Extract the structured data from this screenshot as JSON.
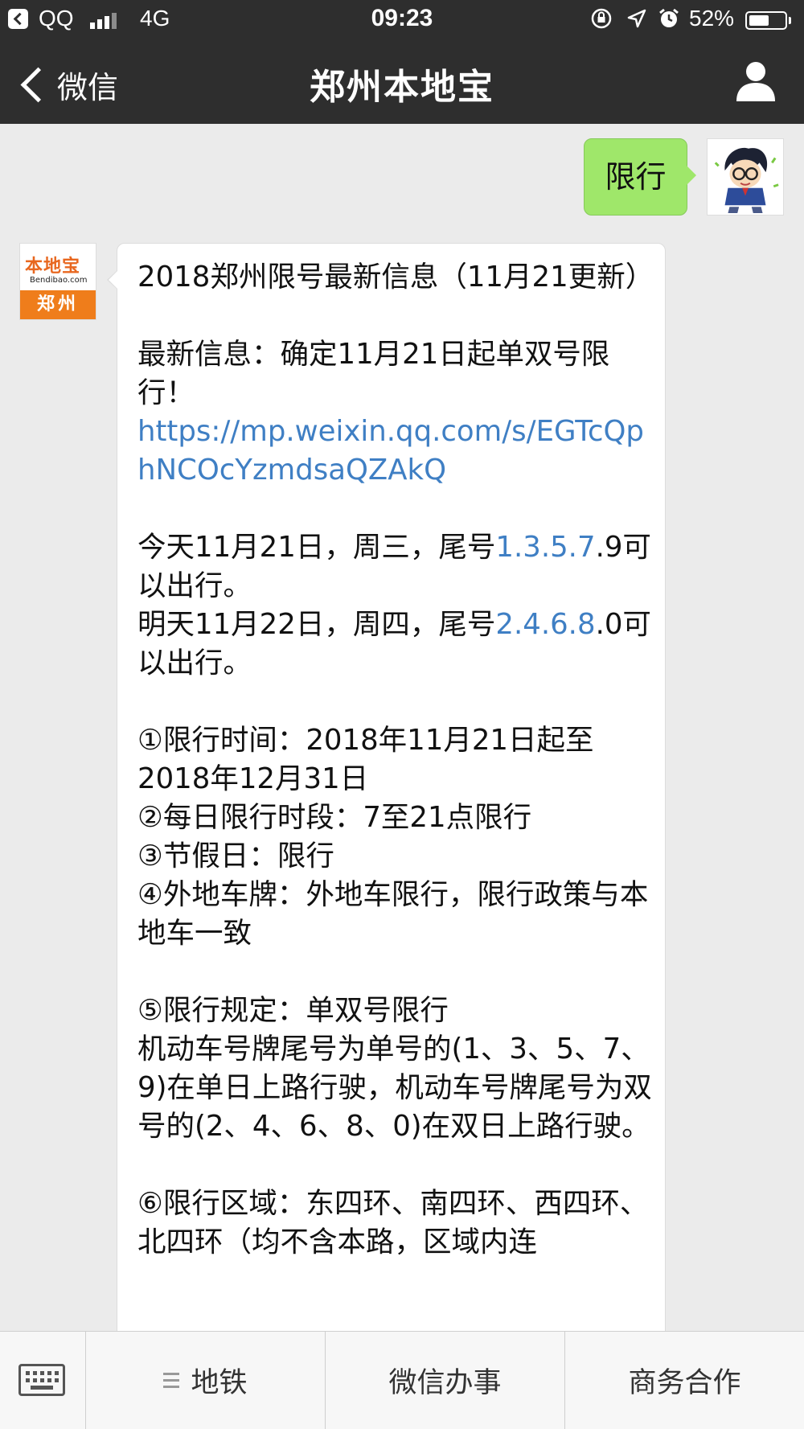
{
  "status_bar": {
    "carrier": "QQ",
    "network": "4G",
    "time": "09:23",
    "battery_percent": "52%",
    "icons": [
      "back-app-icon",
      "signal-icon",
      "orientation-lock-icon",
      "location-icon",
      "alarm-icon",
      "battery-icon"
    ]
  },
  "nav": {
    "back_label": "微信",
    "title": "郑州本地宝",
    "profile_icon": "person-icon"
  },
  "chat": {
    "user_message": "限行",
    "bot_logo": {
      "brand": "本地宝",
      "domain": "Bendibao.com",
      "city": "郑州"
    },
    "bot_message": {
      "line1": "2018郑州限号最新信息（11月21更新）",
      "line2": "最新信息：确定11月21日起单双号限行！",
      "link": "https://mp.weixin.qq.com/s/EGTcQphNCOcYzmdsaQZAkQ",
      "today_prefix": "今天11月21日，周三，尾号",
      "today_blue": "1.3.5.7",
      "today_suffix": ".9可以出行。",
      "tomorrow_prefix": "明天11月22日，周四，尾号",
      "tomorrow_blue": "2.4.6.8",
      "tomorrow_suffix": ".0可以出行。",
      "rule1": "①限行时间：2018年11月21日起至2018年12月31日",
      "rule2": "②每日限行时段：7至21点限行",
      "rule3": "③节假日：限行",
      "rule4": "④外地车牌：外地车限行，限行政策与本地车一致",
      "rule5_title": "⑤限行规定：单双号限行",
      "rule5_body": "机动车号牌尾号为单号的(1、3、5、7、9)在单日上路行驶，机动车号牌尾号为双号的(2、4、6、8、0)在双日上路行驶。",
      "rule6": "⑥限行区域：东四环、南四环、西四环、北四环（均不含本路，区域内连"
    }
  },
  "bottom_menu": {
    "keyboard_icon": "keyboard-icon",
    "items": [
      "地铁",
      "微信办事",
      "商务合作"
    ]
  },
  "colors": {
    "bar_bg": "#2e2e2e",
    "chat_bg": "#ebebeb",
    "user_bubble": "#9fe76a",
    "link": "#3f7fc4",
    "logo_orange": "#ef7d1b"
  }
}
